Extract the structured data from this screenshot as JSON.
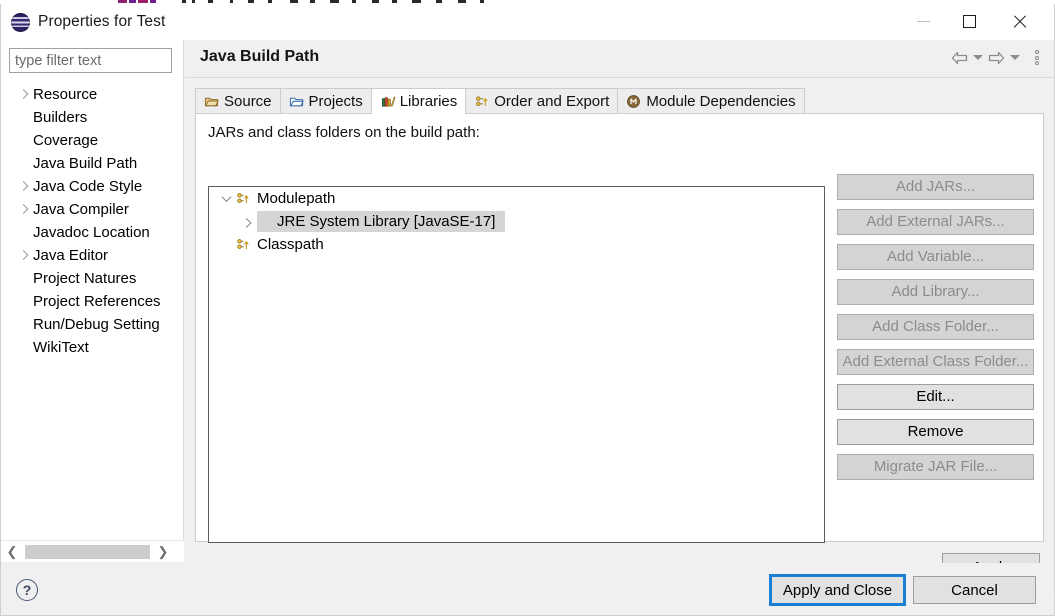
{
  "window": {
    "title": "Properties for Test",
    "logo_icon": "eclipse-logo",
    "minimize_label": "—",
    "maximize_label": "□",
    "close_label": "✕"
  },
  "sidebar": {
    "filter_placeholder": "type filter text",
    "filter_value": "",
    "items": [
      {
        "label": "Resource",
        "expandable": true,
        "selected": false
      },
      {
        "label": "Builders",
        "expandable": false,
        "selected": false
      },
      {
        "label": "Coverage",
        "expandable": false,
        "selected": false
      },
      {
        "label": "Java Build Path",
        "expandable": false,
        "selected": true
      },
      {
        "label": "Java Code Style",
        "expandable": true,
        "selected": false
      },
      {
        "label": "Java Compiler",
        "expandable": true,
        "selected": false
      },
      {
        "label": "Javadoc Location",
        "expandable": false,
        "selected": false
      },
      {
        "label": "Java Editor",
        "expandable": true,
        "selected": false
      },
      {
        "label": "Project Natures",
        "expandable": false,
        "selected": false
      },
      {
        "label": "Project References",
        "expandable": false,
        "selected": false
      },
      {
        "label": "Run/Debug Setting",
        "expandable": false,
        "selected": false
      },
      {
        "label": "WikiText",
        "expandable": false,
        "selected": false
      }
    ],
    "scroll_left_icon": "chevron-left-icon",
    "scroll_right_icon": "chevron-right-icon"
  },
  "header": {
    "page_title": "Java Build Path",
    "back_icon": "back-arrow-icon",
    "back_menu_icon": "chevron-down-icon",
    "forward_icon": "forward-arrow-icon",
    "forward_menu_icon": "chevron-down-icon",
    "overflow_icon": "vertical-dots-icon"
  },
  "tabs": [
    {
      "label": "Source",
      "icon": "source-folder-icon",
      "active": false
    },
    {
      "label": "Projects",
      "icon": "open-folder-icon",
      "active": false
    },
    {
      "label": "Libraries",
      "icon": "books-icon",
      "active": true
    },
    {
      "label": "Order and Export",
      "icon": "order-export-icon",
      "active": false
    },
    {
      "label": "Module Dependencies",
      "icon": "module-circle-icon",
      "active": false
    }
  ],
  "panel": {
    "label": "JARs and class folders on the build path:",
    "tree": [
      {
        "label": "Modulepath",
        "icon": "modulepath-icon",
        "twisty": "open",
        "indent": 0,
        "selected": false
      },
      {
        "label": "JRE System Library [JavaSE-17]",
        "icon": "books-icon",
        "twisty": "closed",
        "indent": 1,
        "selected": true
      },
      {
        "label": "Classpath",
        "icon": "modulepath-icon",
        "twisty": "none",
        "indent": 0,
        "selected": false
      }
    ]
  },
  "side_buttons": [
    {
      "label": "Add JARs...",
      "enabled": false,
      "gap_above": false
    },
    {
      "label": "Add External JARs...",
      "enabled": false,
      "gap_above": false
    },
    {
      "label": "Add Variable...",
      "enabled": false,
      "gap_above": false
    },
    {
      "label": "Add Library...",
      "enabled": false,
      "gap_above": false
    },
    {
      "label": "Add Class Folder...",
      "enabled": false,
      "gap_above": false
    },
    {
      "label": "Add External Class Folder...",
      "enabled": false,
      "gap_above": false
    },
    {
      "label": "Edit...",
      "enabled": true,
      "gap_above": true
    },
    {
      "label": "Remove",
      "enabled": true,
      "gap_above": false
    },
    {
      "label": "Migrate JAR File...",
      "enabled": false,
      "gap_above": true
    }
  ],
  "actions": {
    "apply_label": "Apply",
    "apply_and_close_label": "Apply and Close",
    "cancel_label": "Cancel",
    "help_label": "?"
  },
  "colors": {
    "dialog_bg": "#f0f0f0",
    "panel_bg": "#ffffff",
    "selection": "#d5d5d5",
    "focus_outline": "#1a7fd4",
    "button_enabled": "#e1e1e1",
    "button_disabled": "#d4d4d4",
    "disabled_text": "#8c8c8c"
  }
}
